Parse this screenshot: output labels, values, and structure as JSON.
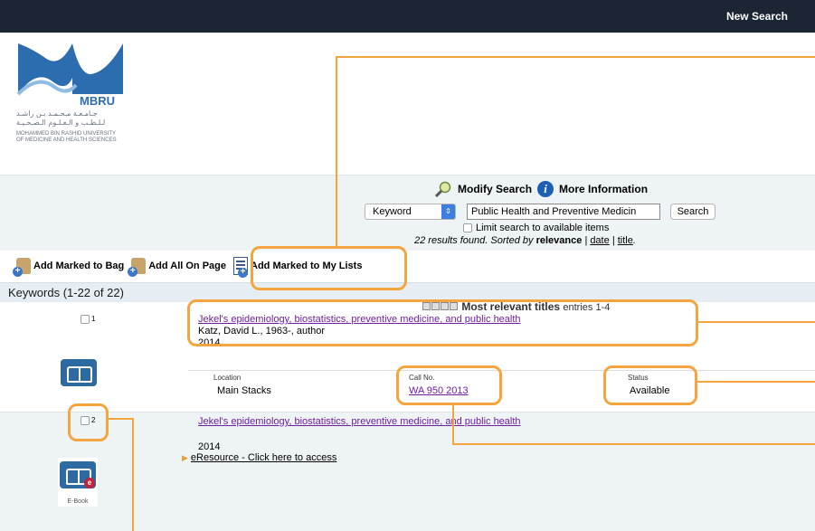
{
  "topbar": {
    "new_search": "New Search"
  },
  "logo": {
    "brand": "MBRU",
    "arabic_line1": "جـامـعـة مـحـمـد بـن راشـد",
    "arabic_line2": "لـلـطـب و الـعـلـوم الـصـحـيـة",
    "english_line1": "MOHAMMED BIN RASHID UNIVERSITY",
    "english_line2": "OF MEDICINE AND HEALTH SCIENCES"
  },
  "search": {
    "modify_label": "Modify Search",
    "more_info_label": "More Information",
    "type_selected": "Keyword",
    "query_value": "Public Health and Preventive Medicin",
    "button_label": "Search",
    "limit_label": "Limit search to available items",
    "results_count": "22 results found.",
    "sorted_by": "Sorted by",
    "sort_relevance": "relevance",
    "sort_date": "date",
    "sort_title": "title",
    "sep1": "|",
    "sep2": "|",
    "trailing": "."
  },
  "actions": {
    "add_marked_bag": "Add Marked to Bag",
    "add_all_page": "Add All On Page",
    "add_marked_lists": "Add Marked to My Lists"
  },
  "keywords_bar": {
    "label": "Keywords (1-22 of 22)"
  },
  "relevance": {
    "label": "Most relevant titles",
    "entries": "entries 1-4"
  },
  "records": [
    {
      "number": "1",
      "title": "Jekel's epidemiology, biostatistics, preventive medicine, and public health",
      "author": "Katz, David L., 1963-, author",
      "year": "2014",
      "holdings_headers": {
        "location": "Location",
        "call_no": "Call No.",
        "status": "Status"
      },
      "location": "Main Stacks",
      "call_no": "WA 950 2013",
      "status": "Available"
    },
    {
      "number": "2",
      "title": "Jekel's epidemiology, biostatistics, preventive medicine, and public health",
      "year": "2014",
      "eresource": "eResource - Click here to access",
      "format_label": "E-Book",
      "badge": "e"
    }
  ],
  "colors": {
    "topbar": "#1c2534",
    "panel": "#eef3f6",
    "annotation": "#f5a540",
    "title_link": "#6f1fa3",
    "brand_blue": "#2d6aa1"
  }
}
